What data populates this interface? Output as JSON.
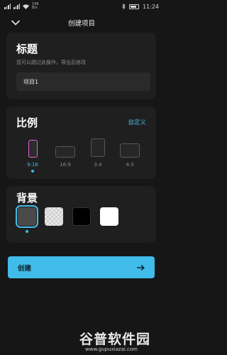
{
  "status_bar": {
    "network_speed": "146\nB/s",
    "battery": "",
    "time": "11:24"
  },
  "header": {
    "title": "创建项目"
  },
  "title_section": {
    "heading": "标题",
    "hint": "您可以跳过此操作，导出后修改",
    "name_value": "项目1"
  },
  "ratio_section": {
    "heading": "比例",
    "custom_label": "自定义",
    "options": [
      {
        "label": "9:16",
        "selected": true
      },
      {
        "label": "16:9",
        "selected": false
      },
      {
        "label": "3:4",
        "selected": false
      },
      {
        "label": "4:3",
        "selected": false
      }
    ]
  },
  "background_section": {
    "heading": "背景",
    "swatches": [
      {
        "name": "dark-gray",
        "color": "#4a4a4a",
        "selected": true
      },
      {
        "name": "transparent",
        "color": "#e0e0e0",
        "selected": false
      },
      {
        "name": "black",
        "color": "#000000",
        "selected": false
      },
      {
        "name": "white",
        "color": "#ffffff",
        "selected": false
      }
    ]
  },
  "actions": {
    "create_label": "创建"
  },
  "watermark": {
    "brand": "谷普软件园",
    "url": "www.gupuxiazai.com"
  },
  "colors": {
    "accent": "#41bbe9",
    "selected_frame": "#e45fd0",
    "background": "#161616",
    "card": "#1f1f1f"
  }
}
